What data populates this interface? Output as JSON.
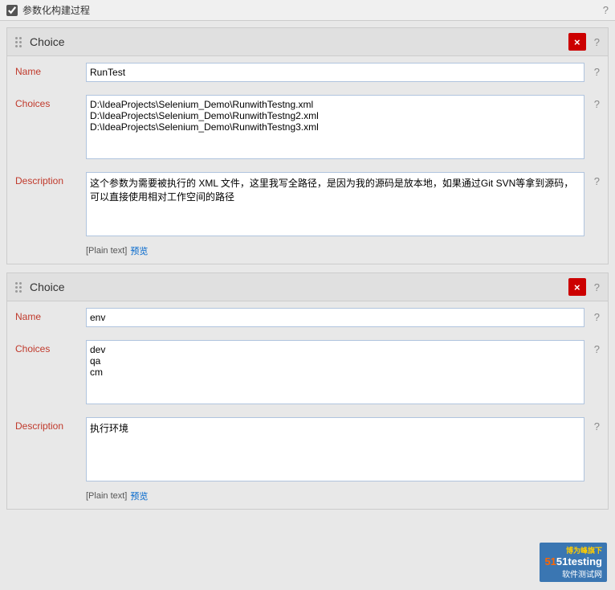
{
  "titleBar": {
    "text": "参数化构建过程",
    "helpLabel": "?"
  },
  "choice1": {
    "title": "Choice",
    "closeBtnLabel": "×",
    "helpLabel": "?",
    "nameLabelText": "Name",
    "nameValue": "RunTest",
    "choicesLabelText": "Choices",
    "choicesValue": "D:\\IdeaProjects\\Selenium_Demo\\RunwithTestng.xml\nD:\\IdeaProjects\\Selenium_Demo\\RunwithTestng2.xml\nD:\\IdeaProjects\\Selenium_Demo\\RunwithTestng3.xml",
    "descLabelText": "Description",
    "descValue": "这个参数为需要被执行的 XML 文件，这里我写全路径，是因为我的源码是放本地，如果通过Git SVN等拿到源码，可以直接使用相对工作空间的路径",
    "plainTextLabel": "[Plain text]",
    "previewLabel": "预览"
  },
  "choice2": {
    "title": "Choice",
    "closeBtnLabel": "×",
    "helpLabel": "?",
    "nameLabelText": "Name",
    "nameValue": "env",
    "choicesLabelText": "Choices",
    "choicesValue": "dev\nqa\ncm",
    "descLabelText": "Description",
    "descValue": "执行环境",
    "plainTextLabel": "[Plain text]",
    "previewLabel": "预览"
  },
  "watermark": {
    "title": "博为峰旗下",
    "brand": "51testing",
    "subtitle": "软件测试网"
  }
}
